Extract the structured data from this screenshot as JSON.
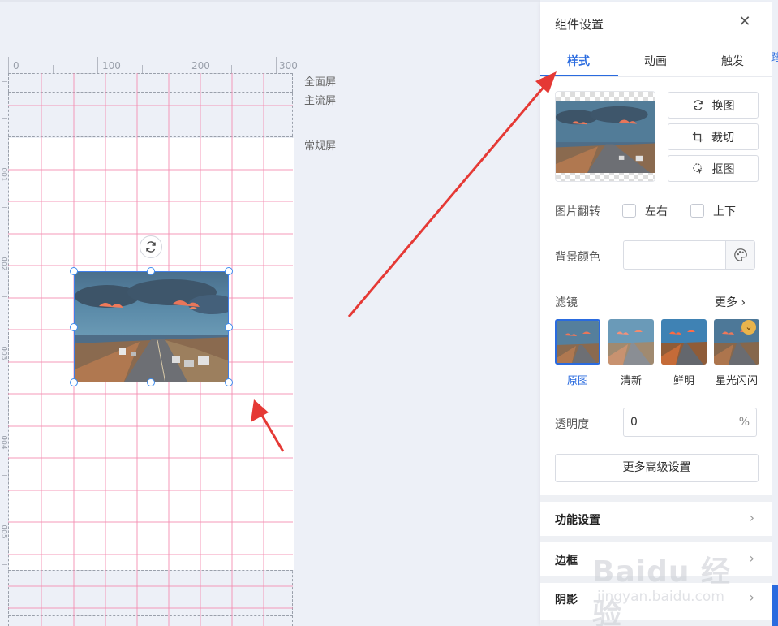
{
  "canvas": {
    "ruler_ticks": [
      "0",
      "100",
      "200",
      "300"
    ],
    "vruler_ticks": [
      "001",
      "002",
      "003",
      "004",
      "005",
      "006"
    ],
    "screen_labels": {
      "full": "全面屏",
      "main": "主流屏",
      "regular": "常规屏"
    }
  },
  "panel": {
    "title": "组件设置",
    "close_glyph": "✕",
    "tabs": [
      {
        "label": "样式",
        "active": true
      },
      {
        "label": "动画",
        "active": false
      },
      {
        "label": "触发",
        "active": false
      }
    ],
    "image_actions": {
      "replace": "换图",
      "crop": "裁切",
      "cutout": "抠图"
    },
    "flip": {
      "label": "图片翻转",
      "horizontal": "左右",
      "vertical": "上下"
    },
    "background": {
      "label": "背景颜色",
      "value": ""
    },
    "filters": {
      "label": "滤镜",
      "more": "更多",
      "items": [
        {
          "name": "原图",
          "selected": true
        },
        {
          "name": "清新",
          "selected": false
        },
        {
          "name": "鲜明",
          "selected": false
        },
        {
          "name": "星光闪闪",
          "selected": false
        }
      ]
    },
    "opacity": {
      "label": "透明度",
      "value": "0",
      "unit": "%"
    },
    "advanced": "更多高级设置",
    "sections": [
      {
        "title": "功能设置"
      },
      {
        "title": "边框"
      },
      {
        "title": "阴影"
      }
    ]
  },
  "right_edge_text": "踏",
  "watermark": {
    "main": "Baidu 经验",
    "sub": "jingyan.baidu.com"
  },
  "colors": {
    "accent": "#2a6bdf",
    "grid": "#f48fb1",
    "arrow": "#e53935"
  }
}
